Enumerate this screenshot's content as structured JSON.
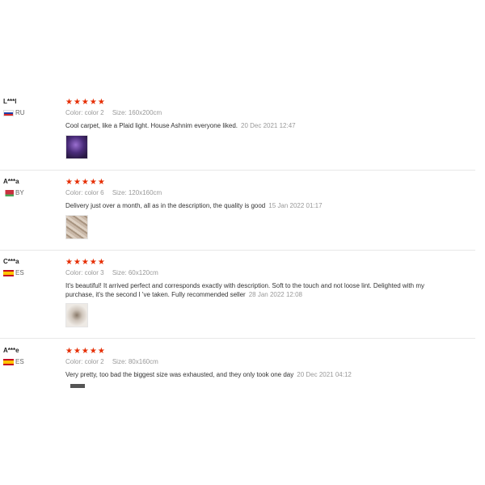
{
  "reviews": [
    {
      "user": "L***l",
      "country": "RU",
      "stars": "★★★★★",
      "color_label": "Color:",
      "color": "color 2",
      "size_label": "Size:",
      "size": "160x200cm",
      "text": "Cool carpet, like a Plaid light. House Ashnim everyone liked.",
      "date": "20 Dec 2021 12:47"
    },
    {
      "user": "A***a",
      "country": "BY",
      "stars": "★★★★★",
      "color_label": "Color:",
      "color": "color 6",
      "size_label": "Size:",
      "size": "120x160cm",
      "text": "Delivery just over a month, all as in the description, the quality is good",
      "date": "15 Jan 2022 01:17"
    },
    {
      "user": "C***a",
      "country": "ES",
      "stars": "★★★★★",
      "color_label": "Color:",
      "color": "color 3",
      "size_label": "Size:",
      "size": "60x120cm",
      "text": "It's beautiful! It arrived perfect and corresponds exactly with description. Soft to the touch and not loose lint. Delighted with my purchase, it's the second I 've taken. Fully recommended seller",
      "date": "28 Jan 2022 12:08"
    },
    {
      "user": "A***e",
      "country": "ES",
      "stars": "★★★★★",
      "color_label": "Color:",
      "color": "color 2",
      "size_label": "Size:",
      "size": "80x160cm",
      "text": "Very pretty, too bad the biggest size was exhausted, and they only took one day",
      "date": "20 Dec 2021 04:12"
    }
  ]
}
